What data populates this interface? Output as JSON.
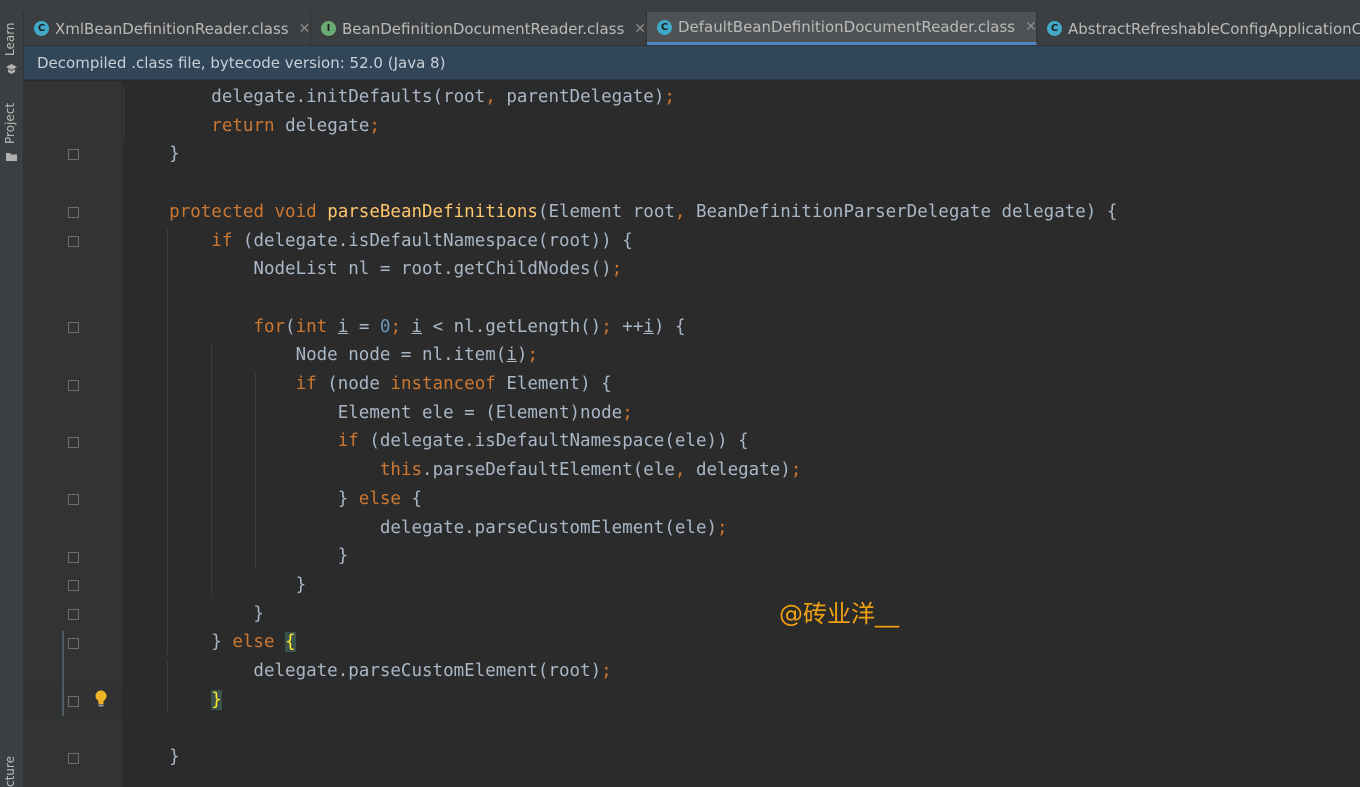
{
  "tool_windows": {
    "learn": "Learn",
    "project": "Project",
    "structure": "cture"
  },
  "tabs": [
    {
      "label": "XmlBeanDefinitionReader.class",
      "icon": "class-icon",
      "icon_letter": "C",
      "color": "#3fa9c7",
      "active": false
    },
    {
      "label": "BeanDefinitionDocumentReader.class",
      "icon": "interface-icon",
      "icon_letter": "I",
      "color": "#6aab73",
      "active": false
    },
    {
      "label": "DefaultBeanDefinitionDocumentReader.class",
      "icon": "class-icon",
      "icon_letter": "C",
      "color": "#3fa9c7",
      "active": true
    },
    {
      "label": "AbstractRefreshableConfigApplicationC",
      "icon": "abstract-class-icon",
      "icon_letter": "C",
      "color": "#3fa9c7",
      "active": false
    }
  ],
  "banner": {
    "text": "Decompiled .class file, bytecode version: 52.0 (Java 8)"
  },
  "code": {
    "lines": [
      [
        {
          "t": "        delegate.initDefaults(root"
        },
        {
          "t": ", ",
          "c": "kw"
        },
        {
          "t": "parentDelegate)"
        },
        {
          "t": ";",
          "c": "kw"
        }
      ],
      [
        {
          "t": "        "
        },
        {
          "t": "return ",
          "c": "kw"
        },
        {
          "t": "delegate"
        },
        {
          "t": ";",
          "c": "kw"
        }
      ],
      [
        {
          "t": "    }"
        }
      ],
      [
        {
          "t": ""
        }
      ],
      [
        {
          "t": "    "
        },
        {
          "t": "protected void ",
          "c": "kw"
        },
        {
          "t": "parseBeanDefinitions",
          "c": "fn"
        },
        {
          "t": "(Element root"
        },
        {
          "t": ", ",
          "c": "kw"
        },
        {
          "t": "BeanDefinitionParserDelegate delegate) {"
        }
      ],
      [
        {
          "t": "        "
        },
        {
          "t": "if ",
          "c": "kw"
        },
        {
          "t": "(delegate.isDefaultNamespace(root)) {"
        }
      ],
      [
        {
          "t": "            NodeList nl = root.getChildNodes()"
        },
        {
          "t": ";",
          "c": "kw"
        }
      ],
      [
        {
          "t": ""
        }
      ],
      [
        {
          "t": "            "
        },
        {
          "t": "for",
          "c": "kw"
        },
        {
          "t": "("
        },
        {
          "t": "int ",
          "c": "kw"
        },
        {
          "t": "i",
          "c": "ul"
        },
        {
          "t": " = "
        },
        {
          "t": "0",
          "c": "num"
        },
        {
          "t": "; ",
          "c": "kw"
        },
        {
          "t": "i",
          "c": "ul"
        },
        {
          "t": " < nl.getLength()"
        },
        {
          "t": "; ",
          "c": "kw"
        },
        {
          "t": "++"
        },
        {
          "t": "i",
          "c": "ul"
        },
        {
          "t": ") {"
        }
      ],
      [
        {
          "t": "                Node node = nl.item("
        },
        {
          "t": "i",
          "c": "ul"
        },
        {
          "t": ")"
        },
        {
          "t": ";",
          "c": "kw"
        }
      ],
      [
        {
          "t": "                "
        },
        {
          "t": "if ",
          "c": "kw"
        },
        {
          "t": "(node "
        },
        {
          "t": "instanceof ",
          "c": "kw"
        },
        {
          "t": "Element) {"
        }
      ],
      [
        {
          "t": "                    Element ele = (Element)node"
        },
        {
          "t": ";",
          "c": "kw"
        }
      ],
      [
        {
          "t": "                    "
        },
        {
          "t": "if ",
          "c": "kw"
        },
        {
          "t": "(delegate.isDefaultNamespace(ele)) {"
        }
      ],
      [
        {
          "t": "                        "
        },
        {
          "t": "this",
          "c": "kw"
        },
        {
          "t": ".parseDefaultElement(ele"
        },
        {
          "t": ", ",
          "c": "kw"
        },
        {
          "t": "delegate)"
        },
        {
          "t": ";",
          "c": "kw"
        }
      ],
      [
        {
          "t": "                    } "
        },
        {
          "t": "else ",
          "c": "kw"
        },
        {
          "t": "{"
        }
      ],
      [
        {
          "t": "                        delegate.parseCustomElement(ele)"
        },
        {
          "t": ";",
          "c": "kw"
        }
      ],
      [
        {
          "t": "                    }"
        }
      ],
      [
        {
          "t": "                }"
        }
      ],
      [
        {
          "t": "            }"
        }
      ],
      [
        {
          "t": "        } "
        },
        {
          "t": "else ",
          "c": "kw"
        },
        {
          "t": "{",
          "c": "brace-hl"
        }
      ],
      [
        {
          "t": "            delegate.parseCustomElement(root)"
        },
        {
          "t": ";",
          "c": "kw"
        }
      ],
      [
        {
          "t": "        "
        },
        {
          "t": "}",
          "c": "brace-hl"
        }
      ],
      [
        {
          "t": ""
        }
      ],
      [
        {
          "t": "    }"
        }
      ]
    ]
  },
  "watermark": "@砖业洋__",
  "colors": {
    "keyword": "#cc7832",
    "method": "#ffc66d",
    "number": "#6897bb",
    "text": "#a9b7c6",
    "background": "#2b2b2b"
  }
}
